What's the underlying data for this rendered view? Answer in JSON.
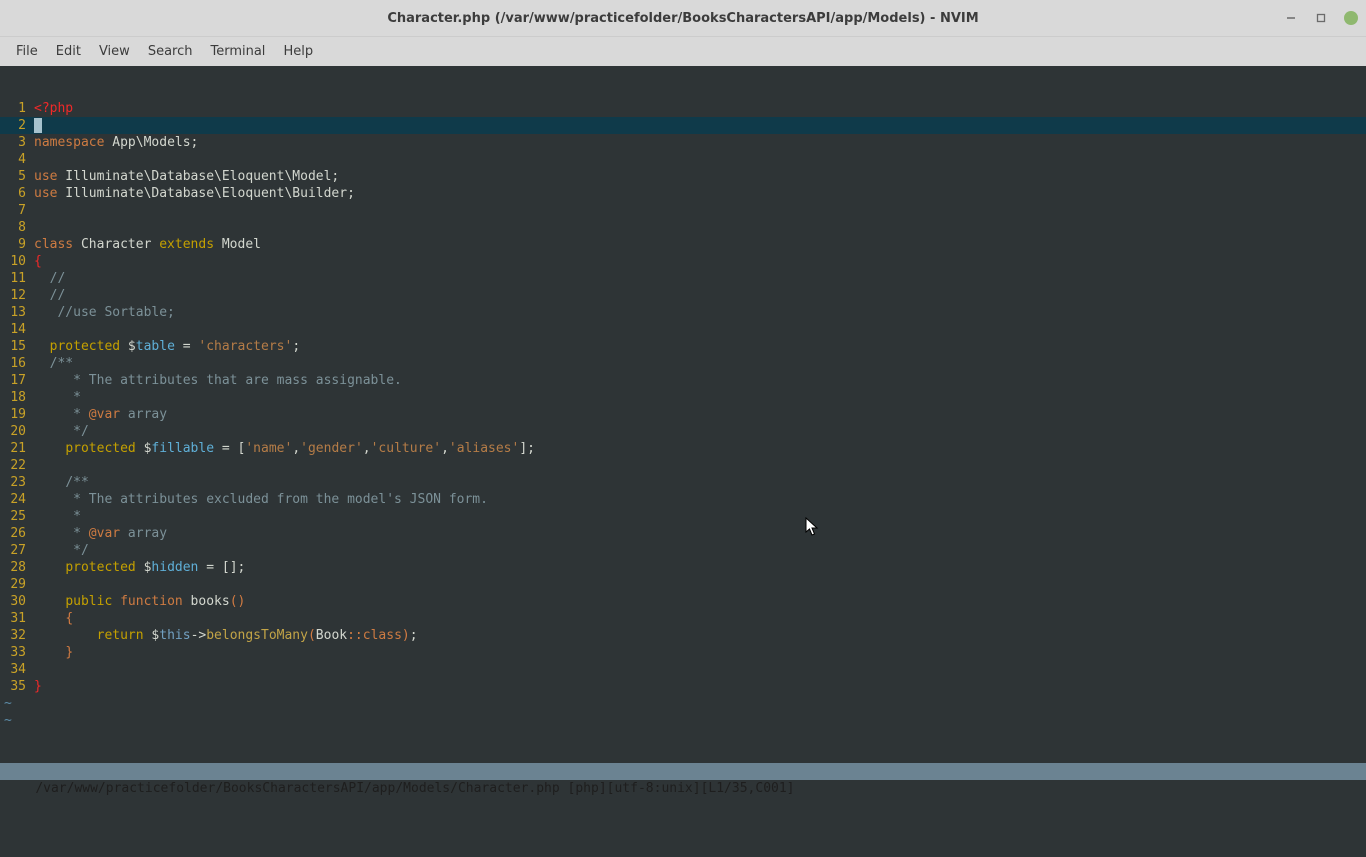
{
  "window": {
    "title": "Character.php (/var/www/practicefolder/BooksCharactersAPI/app/Models) - NVIM"
  },
  "menu": {
    "file": "File",
    "edit": "Edit",
    "view": "View",
    "search": "Search",
    "terminal": "Terminal",
    "help": "Help"
  },
  "gutter": {
    "l1": "1",
    "l2": "2",
    "l3": "3",
    "l4": "4",
    "l5": "5",
    "l6": "6",
    "l7": "7",
    "l8": "8",
    "l9": "9",
    "l10": "10",
    "l11": "11",
    "l12": "12",
    "l13": "13",
    "l14": "14",
    "l15": "15",
    "l16": "16",
    "l17": "17",
    "l18": "18",
    "l19": "19",
    "l20": "20",
    "l21": "21",
    "l22": "22",
    "l23": "23",
    "l24": "24",
    "l25": "25",
    "l26": "26",
    "l27": "27",
    "l28": "28",
    "l29": "29",
    "l30": "30",
    "l31": "31",
    "l32": "32",
    "l33": "33",
    "l34": "34",
    "l35": "35"
  },
  "code": {
    "phpopen": "<?php",
    "namespace_kw": "namespace",
    "namespace_ns": " App\\Models",
    "semicolon": ";",
    "use_kw": "use",
    "use1_ns": " Illuminate\\Database\\Eloquent\\Model",
    "use2_ns": " Illuminate\\Database\\Eloquent\\Builder",
    "class_kw": "class",
    "class_name": " Character ",
    "extends_kw": "extends",
    "extends_name": " Model",
    "brace_open": "{",
    "brace_close": "}",
    "indent2": "  ",
    "indent4": "    ",
    "indent8": "        ",
    "dslash": "//",
    "sortable_cmt": " //use Sortable;",
    "protected_kw": "protected",
    "dollar": " $",
    "table_var": "table",
    "eq": " = ",
    "characters_str": "'characters'",
    "doc_open": "/**",
    "doc_star": " *",
    "doc_close": " */",
    "doc_attr_mass": " * The attributes that are mass assignable.",
    "doc_at": " * ",
    "atvar": "@var",
    "atvar_type": " array",
    "fillable_var": "fillable",
    "arr_open": "[",
    "arr_close": "]",
    "name_str": "'name'",
    "comma": ",",
    "gender_str": "'gender'",
    "culture_str": "'culture'",
    "aliases_str": "'aliases'",
    "doc_attr_hidden": " * The attributes excluded from the model's JSON form.",
    "hidden_var": "hidden",
    "eq2": " = ",
    "empty_arr": "[]",
    "public_kw": "public",
    "function_kw": " function",
    "books_fn": " books",
    "parens": "()",
    "brace_open2": "{",
    "return_kw": "return",
    "this_var": " $",
    "this_kw": "this",
    "arrow": "->",
    "btm": "belongsToMany",
    "paren_open": "(",
    "book_cls": "Book",
    "dblcolon": "::",
    "class_const": "class",
    "paren_close": ")",
    "tilde": "~"
  },
  "status": {
    "text": "/var/www/practicefolder/BooksCharactersAPI/app/Models/Character.php [php][utf-8:unix][L1/35,C001]"
  }
}
